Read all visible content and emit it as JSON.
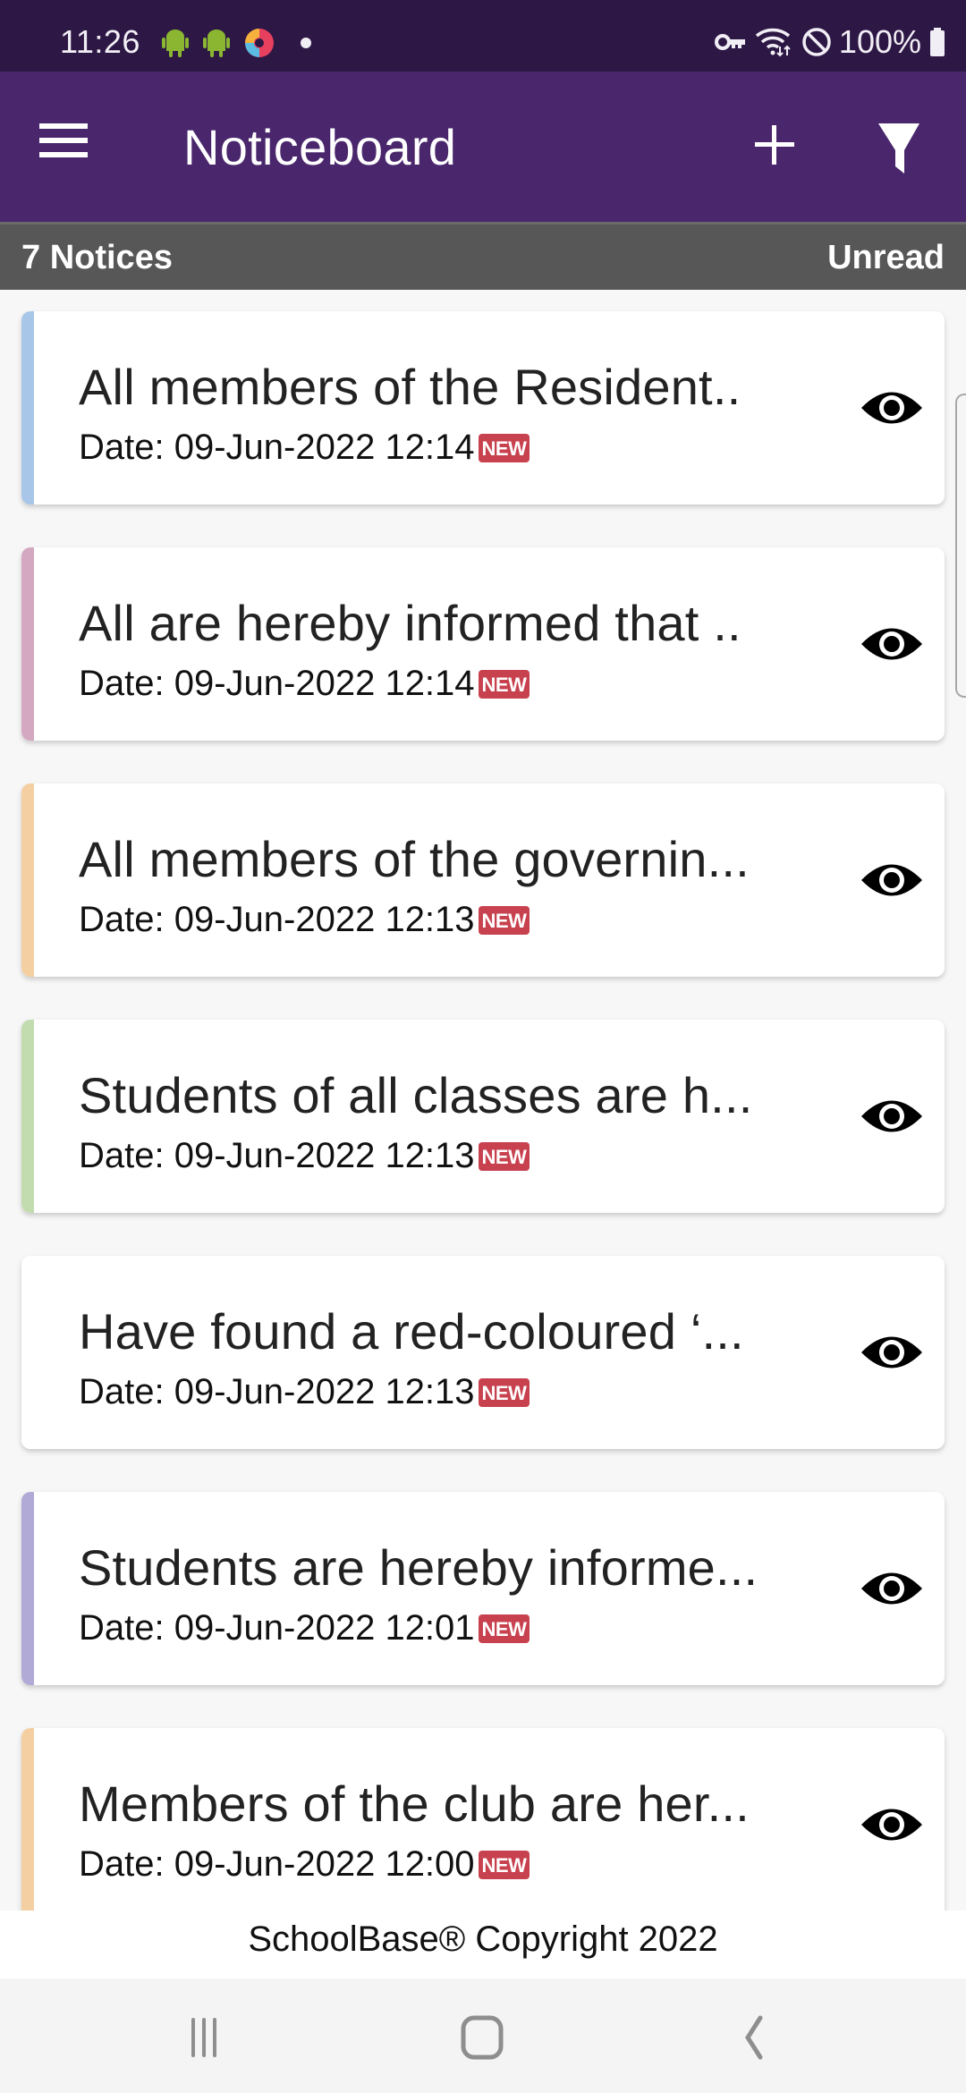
{
  "status_bar": {
    "time": "11:26",
    "left_icons": [
      "android-icon",
      "android-icon",
      "app-notification-icon",
      "dot-icon"
    ],
    "right_icons": [
      "vpn-key-icon",
      "wifi-icon",
      "do-not-disturb-icon"
    ],
    "battery": "100%"
  },
  "app_bar": {
    "title": "Noticeboard",
    "menu_icon": "hamburger-menu-icon",
    "add_icon": "plus-icon",
    "filter_icon": "filter-icon"
  },
  "sub_bar": {
    "count_label": "7 Notices",
    "filter_label": "Unread"
  },
  "notices": [
    {
      "title": "All members of the Resident..",
      "date": "Date: 09-Jun-2022 12:14",
      "badge": "NEW",
      "accent": "#a8c6e8"
    },
    {
      "title": "All are hereby informed that ..",
      "date": "Date: 09-Jun-2022 12:14",
      "badge": "NEW",
      "accent": "#d4a8c0"
    },
    {
      "title": "All members of the governin...",
      "date": "Date: 09-Jun-2022 12:13",
      "badge": "NEW",
      "accent": "#f3cfa2"
    },
    {
      "title": "Students of all classes are h...",
      "date": "Date: 09-Jun-2022 12:13",
      "badge": "NEW",
      "accent": "#c2dcb0"
    },
    {
      "title": "Have found a red-coloured ‘...",
      "date": "Date: 09-Jun-2022 12:13",
      "badge": "NEW",
      "accent": "#ffffff"
    },
    {
      "title": "Students are hereby informe...",
      "date": "Date: 09-Jun-2022 12:01",
      "badge": "NEW",
      "accent": "#b1a9d6"
    },
    {
      "title": "Members of the club are her...",
      "date": "Date: 09-Jun-2022 12:00",
      "badge": "NEW",
      "accent": "#f3cfa2"
    }
  ],
  "footer": {
    "copyright": "SchoolBase® Copyright 2022"
  },
  "nav_bar": {
    "recents": "recents-icon",
    "home": "home-icon",
    "back": "back-icon"
  },
  "colors": {
    "status_bar": "#2d1845",
    "app_bar": "#4a276c",
    "sub_bar": "#575757",
    "new_badge": "#c8414e"
  }
}
